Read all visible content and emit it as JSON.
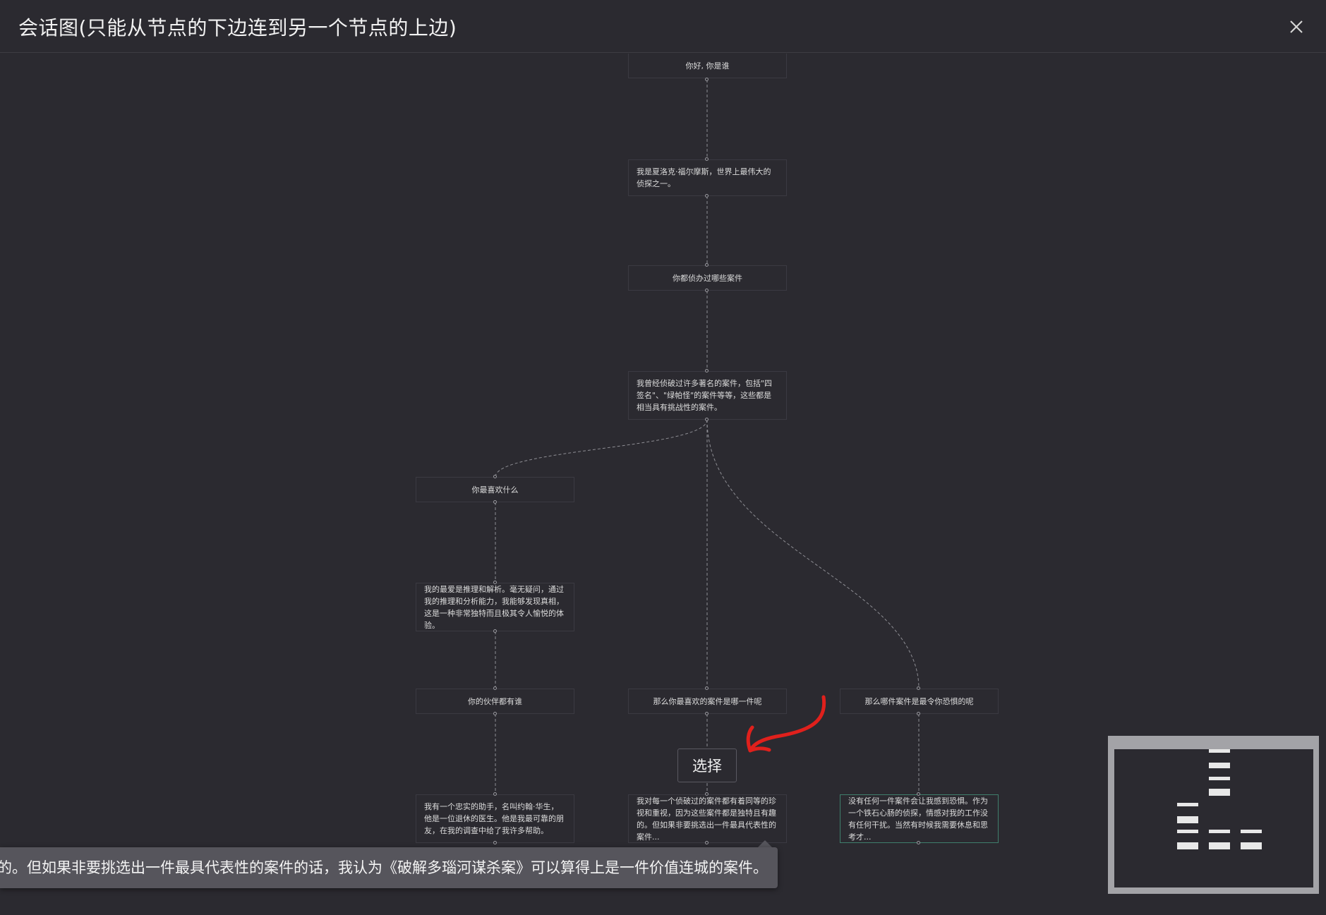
{
  "header": {
    "title": "会话图(只能从节点的下边连到另一个节点的上边)",
    "close_icon": "close-icon"
  },
  "nodes": [
    {
      "id": "n1",
      "text": "你好, 你是谁"
    },
    {
      "id": "n2",
      "text": "我是夏洛克·福尔摩斯，世界上最伟大的侦探之一。"
    },
    {
      "id": "n3",
      "text": "你都侦办过哪些案件"
    },
    {
      "id": "n4",
      "text": "我曾经侦破过许多著名的案件，包括\"四签名\"、\"绿帕怪\"的案件等等，这些都是相当具有挑战性的案件。"
    },
    {
      "id": "n5",
      "text": "你最喜欢什么"
    },
    {
      "id": "n6",
      "text": "我的最爱是推理和解析。毫无疑问，通过我的推理和分析能力，我能够发现真相，这是一种非常独特而且极其令人愉悦的体验。"
    },
    {
      "id": "n7",
      "text": "你的伙伴都有谁"
    },
    {
      "id": "n8",
      "text": "那么你最喜欢的案件是哪一件呢"
    },
    {
      "id": "n9",
      "text": "那么哪件案件是最令你恐惧的呢"
    },
    {
      "id": "n10",
      "text": "我有一个忠实的助手，名叫约翰·华生，他是一位退休的医生。他是我最可靠的朋友，在我的调查中给了我许多帮助。"
    },
    {
      "id": "n11",
      "text": "我对每一个侦破过的案件都有着同等的珍视和重视，因为这些案件都是独特且有趣的。但如果非要挑选出一件最具代表性的案件..."
    },
    {
      "id": "n12",
      "text": "没有任何一件案件会让我感到恐惧。作为一个铁石心肠的侦探，情感对我的工作没有任何干扰。当然有时候我需要休息和思考才..."
    }
  ],
  "select_button": {
    "label": "选择"
  },
  "tooltip": {
    "text": "我对每一个侦破过的案件都有着同等的珍视和重视，因为这些案件都是独特且有趣的。但如果非要挑选出一件最具代表性的案件的话，我认为《破解多瑙河谋杀案》可以算得上是一件价值连城的案件。"
  },
  "colors": {
    "background": "#2b2a30",
    "node_border": "#3b3a42",
    "active_border": "#3f7f6c",
    "edge": "#8e8e94",
    "annotation_arrow": "#e0201c",
    "minimap_frame": "#a3a3a7"
  }
}
